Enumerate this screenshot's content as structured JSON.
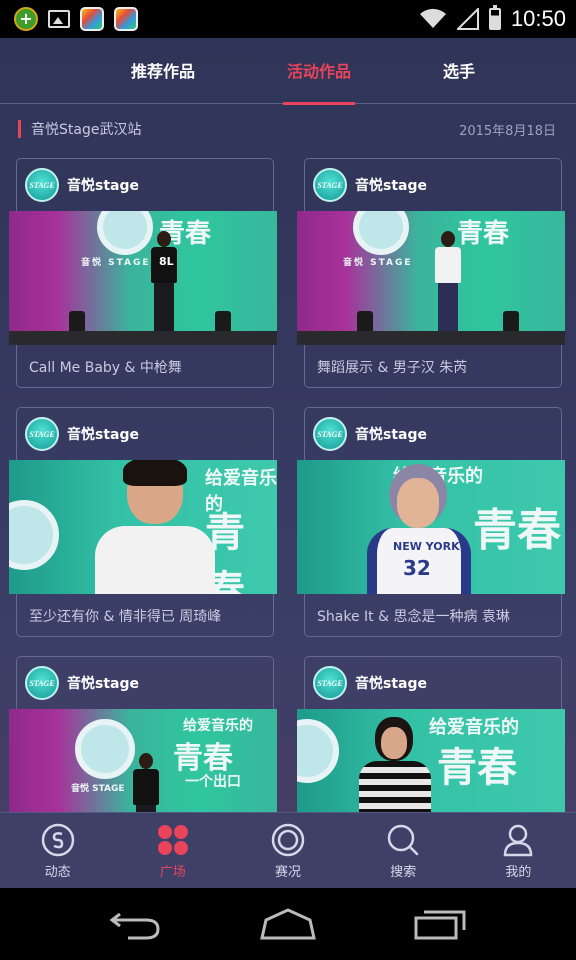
{
  "status_bar": {
    "time": "10:50"
  },
  "top_tabs": [
    {
      "label": "推荐作品"
    },
    {
      "label": "活动作品"
    },
    {
      "label": "选手"
    }
  ],
  "active_top_tab": "活动作品",
  "section": {
    "title": "音悦Stage武汉站",
    "date": "2015年8月18日"
  },
  "cards": [
    {
      "username": "音悦stage",
      "caption": "Call Me Baby & 中枪舞"
    },
    {
      "username": "音悦stage",
      "caption": "舞蹈展示 & 男子汉 朱芮"
    },
    {
      "username": "音悦stage",
      "caption": "至少还有你 & 情非得已 周琦峰"
    },
    {
      "username": "音悦stage",
      "caption": "Shake It & 思念是一种病 袁琳"
    },
    {
      "username": "音悦stage",
      "caption": ""
    },
    {
      "username": "音悦stage",
      "caption": ""
    }
  ],
  "thumb_text": {
    "banner_youth": "青春",
    "banner_love_music": "给爱音乐的",
    "banner_exit": "一个出口",
    "stage_brand": "音悦 STAGE",
    "jersey_number": "32",
    "jersey_team": "NEW YORK",
    "shirt_number": "8L"
  },
  "avatar_text": "STAGE",
  "bottom_nav": [
    {
      "label": "动态",
      "icon": "dynamic-s-icon"
    },
    {
      "label": "广场",
      "icon": "plaza-grid-icon"
    },
    {
      "label": "赛况",
      "icon": "match-target-icon"
    },
    {
      "label": "搜索",
      "icon": "search-icon"
    },
    {
      "label": "我的",
      "icon": "profile-icon"
    }
  ],
  "active_bottom_nav": "广场",
  "colors": {
    "accent": "#e8445a",
    "background": "#35385f",
    "nav_background": "#3f4068",
    "text": "#c9cbe0"
  }
}
